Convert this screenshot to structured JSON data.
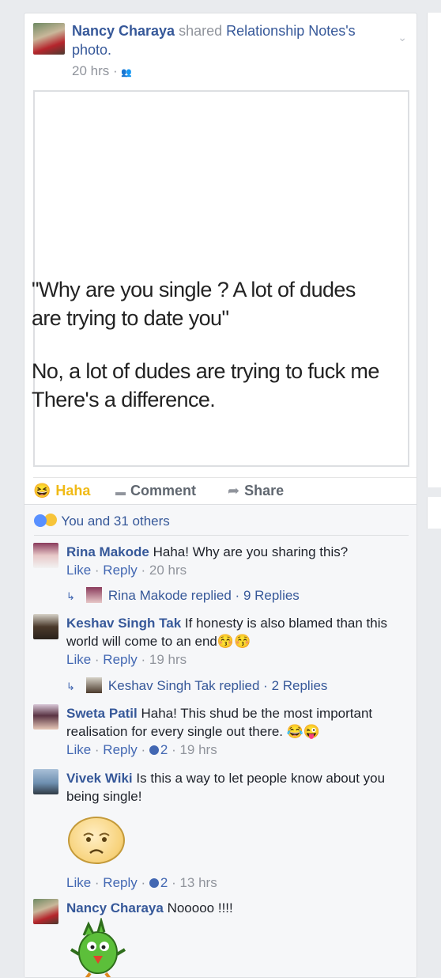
{
  "post": {
    "author": "Nancy Charaya",
    "action": "shared",
    "source": "Relationship Notes's",
    "object": "photo.",
    "time": "20 hrs",
    "audience_icon": "friends-icon",
    "image_lines": [
      "\"Why are you single ? A lot of dudes",
      "are trying to date you\"",
      "No, a lot of dudes are trying to fuck me",
      "There's a difference."
    ]
  },
  "actions": {
    "haha": "Haha",
    "comment": "Comment",
    "share": "Share"
  },
  "reactions": {
    "summary": "You and 31 others"
  },
  "comments": [
    {
      "name": "Rina Makode",
      "text": "Haha! Why are you sharing this?",
      "like": "Like",
      "reply": "Reply",
      "time": "20 hrs",
      "replied": "Rina Makode replied",
      "replies": "9 Replies"
    },
    {
      "name": "Keshav Singh Tak",
      "text": "If honesty is also blamed than this world will come to an end😚😚",
      "like": "Like",
      "reply": "Reply",
      "time": "19 hrs",
      "replied": "Keshav Singh Tak replied",
      "replies": "2 Replies"
    },
    {
      "name": "Sweta Patil",
      "text": "Haha! This shud be the most important realisation for every single out there. 😂😜",
      "like": "Like",
      "reply": "Reply",
      "likes": "2",
      "time": "19 hrs"
    },
    {
      "name": "Vivek Wiki",
      "text": "Is this a way to let people know about you being single!",
      "like": "Like",
      "reply": "Reply",
      "likes": "2",
      "time": "13 hrs"
    },
    {
      "name": "Nancy Charaya",
      "text": "Nooooo !!!!"
    }
  ]
}
